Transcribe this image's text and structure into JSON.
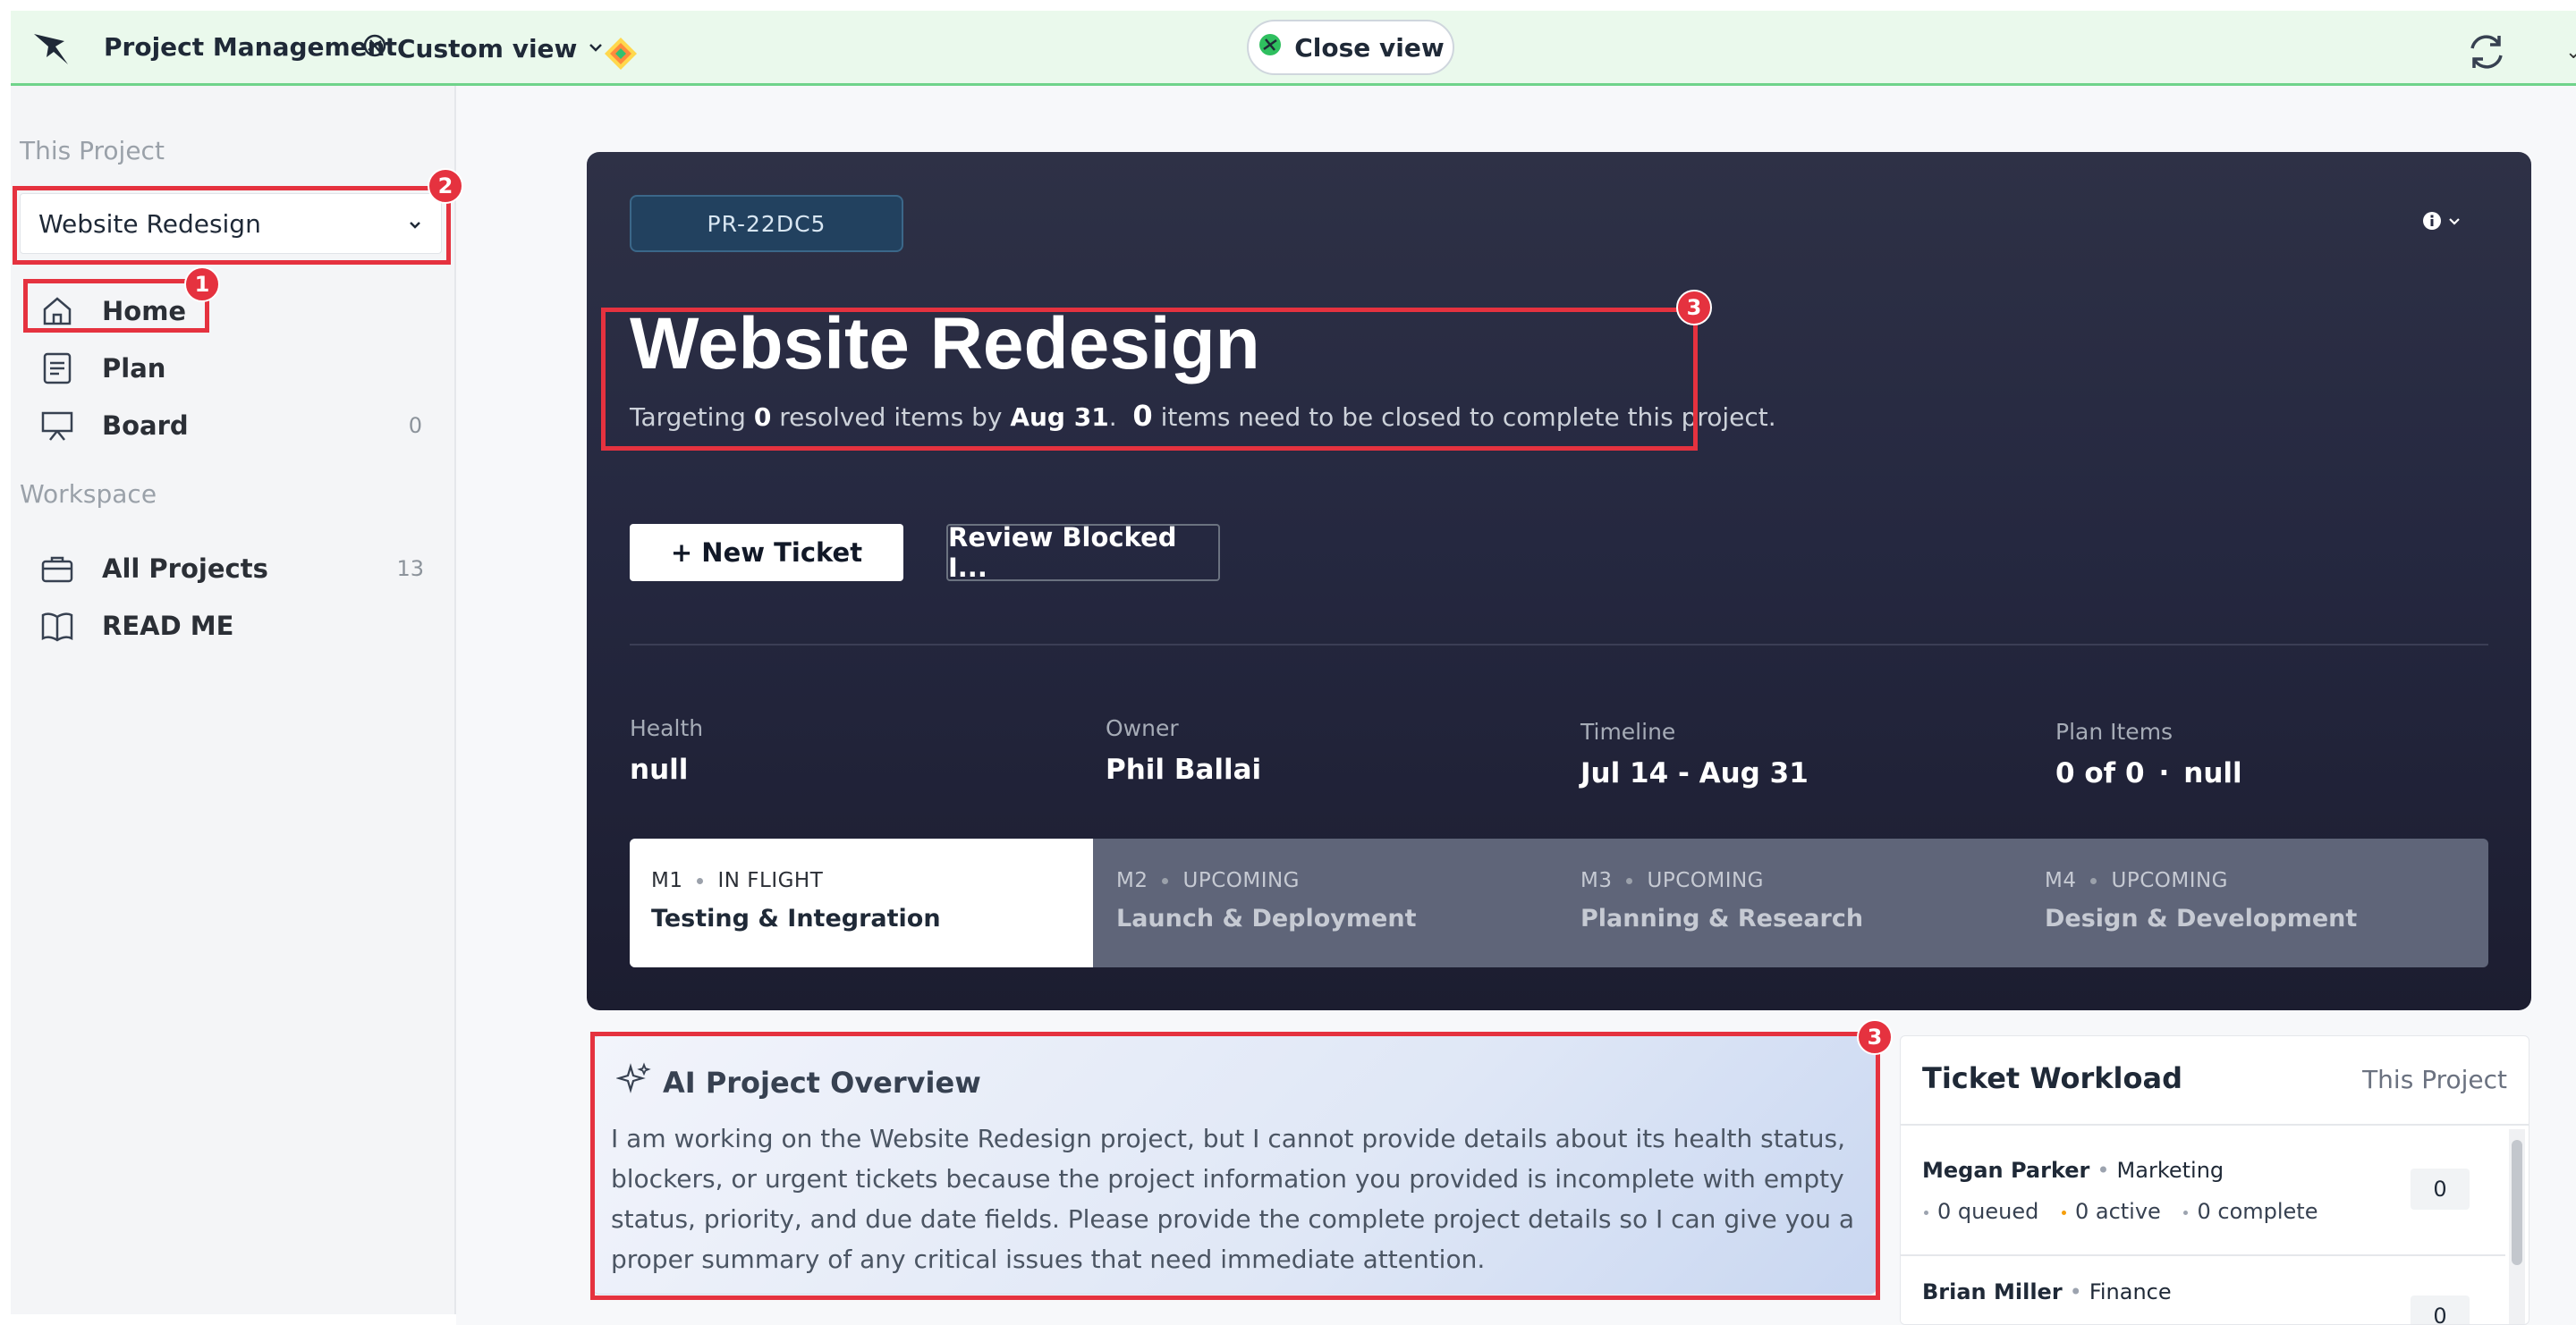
{
  "topbar": {
    "app_title": "Project Management",
    "view_label": "Custom view",
    "close_view_label": "Close view",
    "accent": "#6fd38a"
  },
  "sidebar": {
    "this_project_heading": "This Project",
    "project_select_value": "Website Redesign",
    "project_items": [
      {
        "label": "Home",
        "icon": "home-icon",
        "count": ""
      },
      {
        "label": "Plan",
        "icon": "plan-icon",
        "count": ""
      },
      {
        "label": "Board",
        "icon": "board-icon",
        "count": "0"
      }
    ],
    "workspace_heading": "Workspace",
    "workspace_items": [
      {
        "label": "All Projects",
        "icon": "briefcase-icon",
        "count": "13"
      },
      {
        "label": "READ ME",
        "icon": "book-icon",
        "count": ""
      }
    ]
  },
  "annotations": {
    "a1": "1",
    "a2": "2",
    "a3": "3",
    "a4": "3",
    "color": "#e5323f"
  },
  "hero": {
    "code": "PR-22DC5",
    "title": "Website Redesign",
    "subtitle": {
      "prefix": "Targeting",
      "resolved_count": "0",
      "mid": "resolved items by",
      "date": "Aug 31",
      "remaining_count": "0",
      "suffix": "items need to be closed to complete this project."
    },
    "new_ticket_label": "+ New Ticket",
    "review_label": "Review Blocked I...",
    "stats": [
      {
        "label": "Health",
        "value": "null"
      },
      {
        "label": "Owner",
        "value": "Phil Ballai"
      },
      {
        "label": "Timeline",
        "value": "Jul 14 - Aug 31"
      },
      {
        "label": "Plan Items",
        "value": "0 of 0",
        "extra": "null"
      }
    ],
    "milestones": [
      {
        "code": "M1",
        "status": "IN FLIGHT",
        "name": "Testing & Integration"
      },
      {
        "code": "M2",
        "status": "UPCOMING",
        "name": "Launch & Deployment"
      },
      {
        "code": "M3",
        "status": "UPCOMING",
        "name": "Planning & Research"
      },
      {
        "code": "M4",
        "status": "UPCOMING",
        "name": "Design & Development"
      }
    ]
  },
  "ai_overview": {
    "title": "AI Project Overview",
    "body": "I am working on the Website Redesign project, but I cannot provide details about its health status, blockers, or urgent tickets because the project information you provided is incomplete with empty status, priority, and due date fields. Please provide the complete project details so I can give you a proper summary of any critical issues that need immediate attention."
  },
  "workload": {
    "title": "Ticket Workload",
    "scope": "This Project",
    "rows": [
      {
        "name": "Megan Parker",
        "dept": "Marketing",
        "queued": "0 queued",
        "active": "0 active",
        "complete": "0 complete",
        "total": "0"
      },
      {
        "name": "Brian Miller",
        "dept": "Finance",
        "queued": "",
        "active": "",
        "complete": "",
        "total": "0"
      }
    ]
  }
}
